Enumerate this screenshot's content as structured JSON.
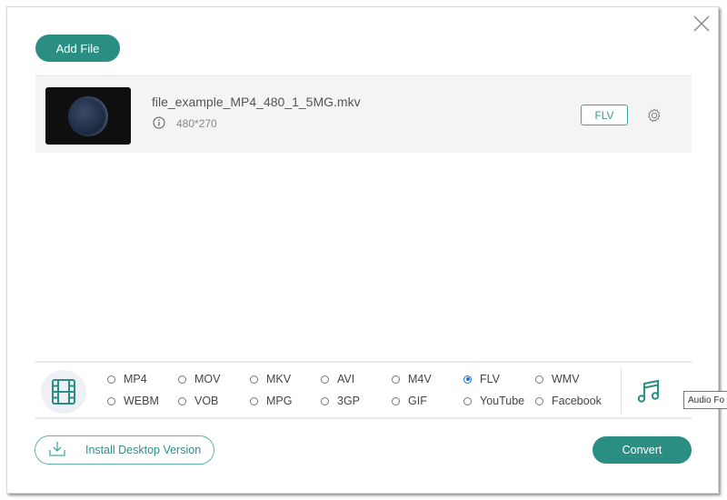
{
  "toolbar": {
    "add_file_label": "Add File"
  },
  "file": {
    "name": "file_example_MP4_480_1_5MG.mkv",
    "resolution": "480*270",
    "output_format": "FLV"
  },
  "formats": {
    "video_options": [
      {
        "label": "MP4",
        "selected": false
      },
      {
        "label": "MOV",
        "selected": false
      },
      {
        "label": "MKV",
        "selected": false
      },
      {
        "label": "AVI",
        "selected": false
      },
      {
        "label": "M4V",
        "selected": false
      },
      {
        "label": "FLV",
        "selected": true
      },
      {
        "label": "WMV",
        "selected": false
      },
      {
        "label": "WEBM",
        "selected": false
      },
      {
        "label": "VOB",
        "selected": false
      },
      {
        "label": "MPG",
        "selected": false
      },
      {
        "label": "3GP",
        "selected": false
      },
      {
        "label": "GIF",
        "selected": false
      },
      {
        "label": "YouTube",
        "selected": false
      },
      {
        "label": "Facebook",
        "selected": false
      }
    ],
    "audio_tooltip": "Audio Fo"
  },
  "footer": {
    "install_label": "Install Desktop Version",
    "convert_label": "Convert"
  },
  "colors": {
    "accent": "#2a8f82",
    "radio_selected": "#1e6fd9"
  }
}
